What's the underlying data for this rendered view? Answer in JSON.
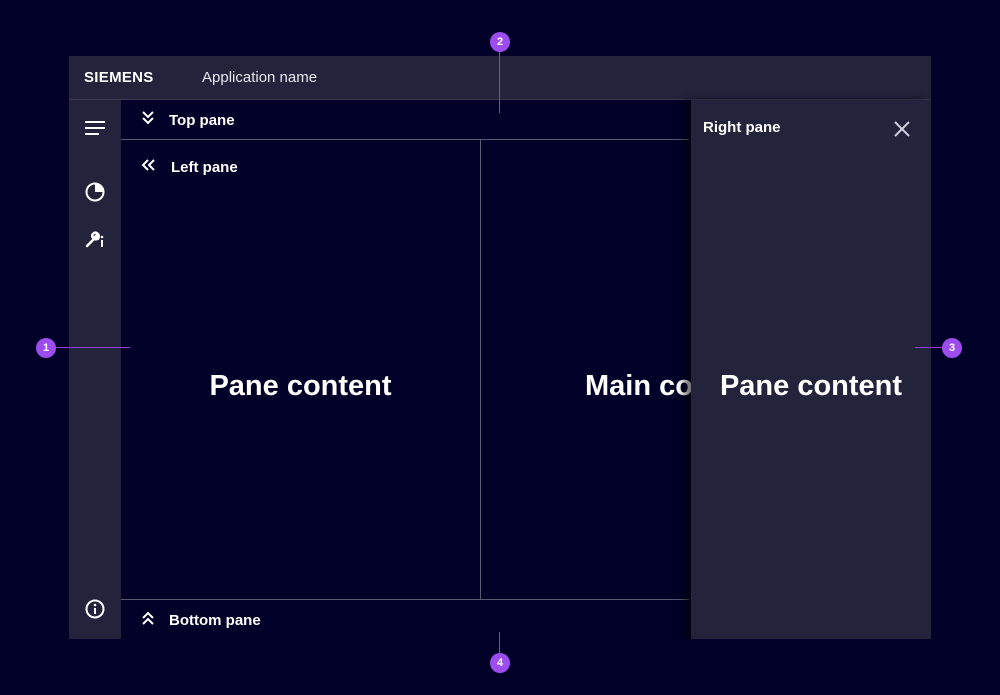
{
  "header": {
    "brand": "SIEMENS",
    "app_name": "Application name"
  },
  "sidebar": {
    "items": [
      {
        "icon": "menu-icon"
      },
      {
        "icon": "pie-chart-icon"
      },
      {
        "icon": "wrench-info-icon"
      },
      {
        "icon": "info-icon"
      }
    ]
  },
  "top_pane": {
    "label": "Top pane",
    "icon": "chevron-double-down-icon"
  },
  "left_pane": {
    "label": "Left pane",
    "icon": "chevron-double-left-icon",
    "content": "Pane content"
  },
  "main": {
    "content": "Main co"
  },
  "bottom_pane": {
    "label": "Bottom pane",
    "icon": "chevron-double-up-icon"
  },
  "right_pane": {
    "title": "Right pane",
    "content": "Pane content",
    "close_icon": "close-icon"
  },
  "markers": [
    "1",
    "2",
    "3",
    "4"
  ],
  "colors": {
    "background": "#000028",
    "panel": "#23233c",
    "accent": "#9d4cf0",
    "divider": "#5a5a72"
  }
}
